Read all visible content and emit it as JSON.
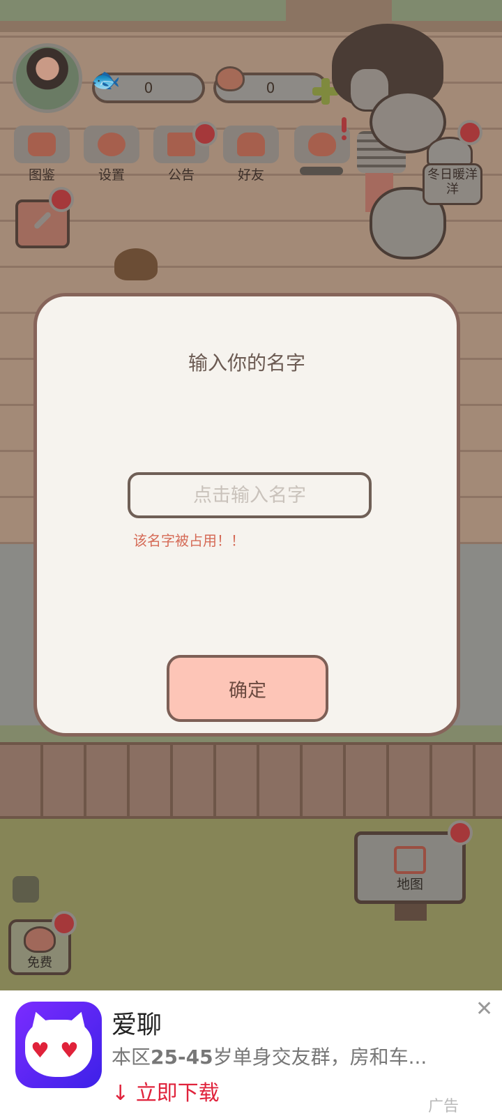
{
  "hud": {
    "fish_count": "0",
    "heart_count": "0"
  },
  "menu": {
    "items": [
      {
        "label": "图鉴",
        "icon": "cat-head-icon"
      },
      {
        "label": "设置",
        "icon": "gear-icon"
      },
      {
        "label": "公告",
        "icon": "gift-icon"
      },
      {
        "label": "好友",
        "icon": "friends-icon"
      },
      {
        "label": "",
        "icon": "hearts-icon"
      }
    ]
  },
  "event": {
    "label": "冬日暖洋洋"
  },
  "dialog": {
    "title": "输入你的名字",
    "input_placeholder": "点击输入名字",
    "input_value": "",
    "error": "该名字被占用！！",
    "confirm_label": "确定"
  },
  "bottom": {
    "free_label": "免费",
    "map_label": "地图"
  },
  "ad": {
    "app_name": "爱聊",
    "description_prefix": "本区",
    "description_emph": "25-45",
    "description_suffix": "岁单身交友群，房和车...",
    "cta": "立即下载",
    "cta_icon": "download-arrow-icon",
    "close_icon": "close-icon",
    "tag": "广告"
  },
  "colors": {
    "dialog_bg": "#f6f3ee",
    "dialog_border": "#86645a",
    "confirm_bg": "#fdc5b7",
    "error_text": "#d56a56",
    "ad_cta": "#e0233c",
    "badge_red": "#a5383a"
  }
}
